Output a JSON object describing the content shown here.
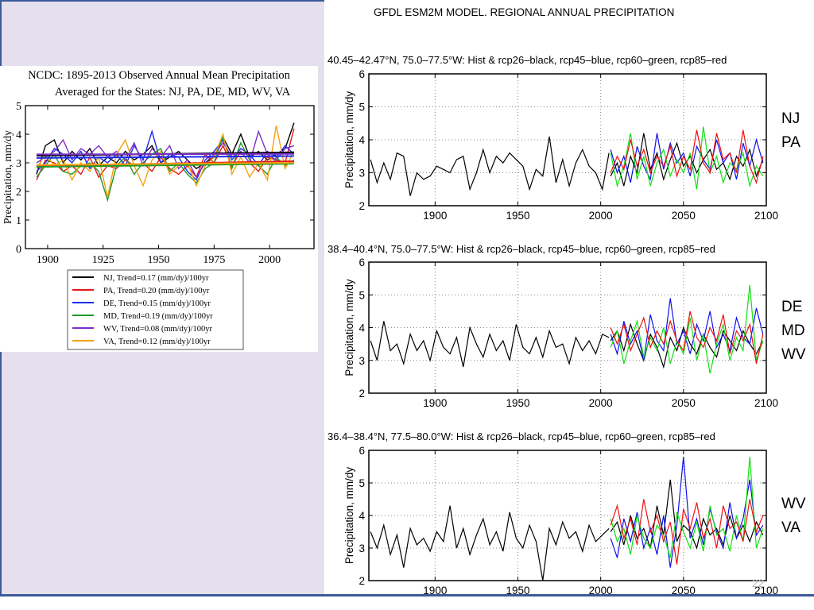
{
  "slide": {
    "right_title": "GFDL ESM2M MODEL.  REGIONAL ANNUAL PRECIPITATION",
    "page_number": "22",
    "region_labels": [
      [
        "NJ",
        "PA"
      ],
      [
        "DE",
        "MD",
        "WV"
      ],
      [
        "WV",
        "VA"
      ]
    ],
    "background_color": "#e6e0ee",
    "border_color": "#3b5a9a"
  },
  "chart_data": [
    {
      "type": "line",
      "title": "NCDC: 1895-2013 Observed Annual Mean Precipitation",
      "subtitle": "Averaged for the States: NJ, PA, DE, MD, WV, VA",
      "xlabel": "",
      "ylabel": "Precipitation, mm/dy",
      "xlim": [
        1890,
        2020
      ],
      "ylim": [
        0,
        5
      ],
      "xticks": [
        1900,
        1925,
        1950,
        1975,
        2000
      ],
      "yticks": [
        0,
        1,
        2,
        3,
        4,
        5
      ],
      "grid": false,
      "legend": "bottom",
      "x_start": 1895,
      "x_step": 4,
      "series": [
        {
          "name": "NJ, Trend=0.17 (mm/dy)/100yr",
          "color": "#000000",
          "values": [
            2.6,
            3.6,
            3.8,
            3.0,
            3.4,
            3.1,
            3.5,
            2.9,
            3.2,
            3.0,
            3.4,
            3.1,
            3.3,
            3.6,
            3.0,
            3.2,
            3.4,
            3.1,
            2.8,
            3.0,
            3.2,
            3.9,
            3.3,
            4.0,
            3.2,
            3.4,
            3.1,
            3.3,
            3.5,
            4.4
          ]
        },
        {
          "name": "PA, Trend=0.20 (mm/dy)/100yr",
          "color": "#e8141c",
          "values": [
            2.4,
            3.1,
            3.0,
            2.7,
            2.9,
            2.6,
            3.2,
            2.5,
            2.9,
            2.8,
            3.1,
            2.9,
            3.0,
            2.7,
            3.2,
            2.8,
            2.6,
            2.9,
            2.5,
            3.3,
            3.0,
            3.6,
            2.9,
            3.4,
            3.0,
            2.7,
            3.2,
            3.1,
            3.0,
            4.2
          ]
        },
        {
          "name": "DE, Trend=0.15 (mm/dy)/100yr",
          "color": "#1a2cf0",
          "values": [
            2.7,
            3.0,
            3.5,
            3.3,
            3.0,
            3.4,
            2.8,
            3.2,
            3.0,
            3.3,
            2.9,
            3.6,
            3.1,
            4.1,
            3.0,
            3.3,
            3.2,
            2.7,
            2.4,
            3.1,
            3.4,
            3.8,
            3.1,
            3.5,
            3.3,
            2.9,
            3.4,
            3.2,
            3.6,
            3.3
          ]
        },
        {
          "name": "MD, Trend=0.19 (mm/dy)/100yr",
          "color": "#1f9a2a",
          "values": [
            2.5,
            2.9,
            3.3,
            2.7,
            2.6,
            2.9,
            3.0,
            2.7,
            1.7,
            2.9,
            3.2,
            2.6,
            3.0,
            3.3,
            3.5,
            2.7,
            3.0,
            2.6,
            2.3,
            2.8,
            3.0,
            3.9,
            2.8,
            3.7,
            3.1,
            2.9,
            2.6,
            3.2,
            2.9,
            3.1
          ]
        },
        {
          "name": "WV, Trend=0.08 (mm/dy)/100yr",
          "color": "#7b2fc8",
          "values": [
            3.0,
            3.2,
            3.4,
            3.8,
            3.1,
            3.5,
            3.3,
            3.6,
            3.2,
            3.4,
            3.1,
            3.7,
            2.9,
            3.5,
            3.2,
            3.6,
            2.8,
            3.1,
            2.5,
            3.0,
            3.3,
            3.7,
            3.2,
            3.4,
            3.0,
            4.1,
            3.3,
            3.1,
            3.5,
            3.6
          ]
        },
        {
          "name": "VA, Trend=0.12 (mm/dy)/100yr",
          "color": "#f5a20f",
          "values": [
            2.8,
            3.3,
            2.9,
            3.1,
            2.4,
            3.0,
            2.7,
            3.2,
            1.8,
            3.3,
            3.8,
            2.9,
            2.2,
            3.1,
            3.4,
            2.6,
            2.9,
            3.0,
            2.2,
            2.9,
            3.2,
            4.0,
            2.6,
            3.2,
            2.5,
            3.0,
            2.4,
            4.3,
            2.8,
            3.4
          ]
        }
      ]
    },
    {
      "type": "line",
      "title": "40.45–42.47°N, 75.0–77.5°W: Hist & rcp26–black, rcp45–blue, rcp60–green, rcp85–red",
      "ylabel": "Precipitation, mm/dy",
      "xlim": [
        1860,
        2100
      ],
      "ylim": [
        2,
        6
      ],
      "xticks": [
        1900,
        1950,
        2000,
        2050,
        2100
      ],
      "yticks": [
        2,
        3,
        4,
        5,
        6
      ],
      "grid": true,
      "hist": {
        "x_start": 1861,
        "x_step": 4,
        "color": "#000000",
        "values": [
          3.4,
          2.7,
          3.3,
          2.8,
          3.6,
          3.5,
          2.3,
          3.0,
          2.8,
          2.9,
          3.2,
          3.1,
          3.0,
          3.4,
          3.5,
          2.5,
          3.0,
          3.7,
          3.0,
          3.5,
          3.3,
          3.6,
          3.4,
          3.2,
          2.5,
          3.1,
          2.9,
          4.1,
          2.7,
          3.4,
          2.6,
          3.3,
          3.7,
          3.2,
          3.0,
          2.5,
          3.6
        ]
      },
      "projections": {
        "x_start": 2006,
        "x_step": 4,
        "series": [
          {
            "name": "rcp26",
            "color": "#000000",
            "values": [
              2.9,
              3.3,
              2.6,
              3.5,
              3.0,
              4.2,
              3.1,
              3.6,
              2.8,
              3.4,
              3.9,
              3.2,
              3.5,
              3.0,
              3.4,
              3.7,
              3.1,
              3.3,
              2.8,
              3.5,
              3.2,
              3.7,
              2.9,
              3.4
            ]
          },
          {
            "name": "rcp45",
            "color": "#1010ee",
            "values": [
              3.7,
              3.0,
              3.5,
              2.7,
              3.8,
              3.2,
              2.8,
              4.2,
              3.1,
              3.9,
              3.3,
              3.6,
              2.9,
              3.8,
              3.4,
              3.1,
              4.0,
              3.3,
              3.6,
              2.8,
              3.9,
              3.2,
              4.0,
              3.3
            ]
          },
          {
            "name": "rcp60",
            "color": "#10e010",
            "values": [
              3.6,
              2.6,
              3.2,
              4.2,
              2.8,
              3.5,
              2.6,
              3.3,
              3.7,
              2.9,
              3.4,
              3.0,
              3.6,
              2.5,
              4.4,
              3.0,
              3.5,
              2.7,
              3.3,
              3.1,
              3.6,
              2.6,
              3.2,
              2.9
            ]
          },
          {
            "name": "rcp85",
            "color": "#ee1010",
            "values": [
              3.0,
              3.5,
              3.1,
              4.0,
              3.2,
              3.7,
              3.0,
              3.5,
              3.2,
              3.8,
              2.9,
              3.5,
              3.1,
              4.3,
              3.3,
              3.0,
              4.2,
              3.4,
              3.6,
              3.0,
              4.3,
              3.2,
              2.7,
              3.5
            ]
          }
        ]
      }
    },
    {
      "type": "line",
      "title": "38.4–40.4°N, 75.0–77.5°W: Hist & rcp26–black, rcp45–blue, rcp60–green, rcp85–red",
      "ylabel": "Precipitation, mm/dy",
      "xlim": [
        1860,
        2100
      ],
      "ylim": [
        2,
        6
      ],
      "xticks": [
        1900,
        1950,
        2000,
        2050,
        2100
      ],
      "yticks": [
        2,
        3,
        4,
        5,
        6
      ],
      "grid": true,
      "hist": {
        "x_start": 1861,
        "x_step": 4,
        "color": "#000000",
        "values": [
          3.6,
          3.0,
          4.2,
          3.3,
          3.5,
          2.9,
          3.8,
          3.3,
          3.6,
          3.0,
          3.9,
          3.4,
          3.2,
          3.7,
          2.8,
          4.0,
          3.5,
          3.1,
          3.8,
          3.3,
          3.6,
          3.0,
          4.1,
          3.4,
          3.2,
          3.7,
          3.1,
          3.9,
          3.4,
          3.5,
          2.9,
          3.7,
          3.3,
          3.6,
          3.2,
          3.8,
          3.7
        ]
      },
      "projections": {
        "x_start": 2006,
        "x_step": 4,
        "series": [
          {
            "name": "rcp26",
            "color": "#000000",
            "values": [
              3.6,
              3.9,
              3.3,
              4.1,
              3.5,
              3.0,
              3.8,
              3.4,
              2.8,
              3.7,
              3.3,
              4.0,
              3.5,
              3.2,
              3.8,
              3.4,
              3.1,
              3.9,
              3.6,
              3.3,
              3.9,
              3.5,
              3.2,
              3.6
            ]
          },
          {
            "name": "rcp45",
            "color": "#1010ee",
            "values": [
              3.8,
              3.2,
              4.2,
              3.5,
              3.9,
              3.0,
              4.4,
              3.6,
              3.3,
              4.9,
              3.5,
              3.9,
              3.2,
              4.1,
              3.6,
              4.5,
              3.4,
              3.8,
              3.3,
              4.3,
              3.7,
              3.5,
              4.6,
              3.8
            ]
          },
          {
            "name": "rcp60",
            "color": "#10e010",
            "values": [
              3.4,
              3.9,
              2.9,
              3.6,
              4.2,
              3.1,
              3.7,
              3.3,
              4.0,
              2.9,
              3.6,
              3.2,
              4.3,
              3.0,
              3.8,
              2.6,
              3.5,
              4.1,
              3.0,
              3.7,
              3.3,
              5.3,
              3.0,
              3.6
            ]
          },
          {
            "name": "rcp85",
            "color": "#ee1010",
            "values": [
              4.0,
              3.5,
              4.1,
              3.3,
              3.8,
              4.3,
              3.4,
              3.9,
              3.5,
              4.2,
              3.6,
              3.3,
              4.5,
              3.7,
              3.4,
              4.0,
              3.6,
              4.4,
              3.2,
              3.9,
              3.6,
              4.1,
              2.9,
              3.8
            ]
          }
        ]
      }
    },
    {
      "type": "line",
      "title": "36.4–38.4°N, 77.5–80.0°W: Hist & rcp26–black, rcp45–blue, rcp60–green, rcp85–red",
      "ylabel": "Precipitation, mm/dy",
      "xlim": [
        1860,
        2100
      ],
      "ylim": [
        2,
        6
      ],
      "xticks": [
        1900,
        1950,
        2000,
        2050,
        2100
      ],
      "yticks": [
        2,
        3,
        4,
        5,
        6
      ],
      "grid": true,
      "hist": {
        "x_start": 1861,
        "x_step": 4,
        "color": "#000000",
        "values": [
          3.5,
          3.0,
          3.7,
          2.8,
          3.4,
          2.4,
          3.6,
          3.1,
          3.3,
          2.9,
          3.5,
          3.2,
          4.3,
          3.0,
          3.6,
          2.8,
          3.4,
          3.9,
          3.1,
          3.5,
          2.9,
          4.1,
          3.3,
          3.0,
          3.7,
          3.2,
          2.0,
          3.6,
          3.1,
          3.8,
          3.3,
          3.5,
          2.9,
          3.7,
          3.2,
          3.4,
          3.6
        ]
      },
      "projections": {
        "x_start": 2006,
        "x_step": 4,
        "series": [
          {
            "name": "rcp26",
            "color": "#000000",
            "values": [
              3.5,
              3.8,
              3.1,
              4.0,
              3.3,
              3.6,
              3.0,
              4.3,
              3.4,
              5.1,
              3.2,
              3.7,
              3.5,
              3.0,
              3.9,
              3.4,
              3.6,
              3.1,
              4.0,
              3.3,
              3.7,
              3.2,
              3.8,
              3.4
            ]
          },
          {
            "name": "rcp45",
            "color": "#1010ee",
            "values": [
              3.3,
              2.7,
              3.9,
              3.2,
              4.1,
              3.0,
              3.6,
              2.8,
              4.0,
              2.4,
              3.7,
              5.8,
              3.3,
              3.9,
              3.1,
              4.2,
              3.5,
              3.0,
              4.4,
              3.3,
              3.9,
              5.1,
              3.4,
              3.7
            ]
          },
          {
            "name": "rcp60",
            "color": "#10e010",
            "values": [
              3.9,
              3.2,
              3.6,
              2.8,
              4.0,
              3.3,
              3.0,
              3.7,
              3.4,
              2.7,
              4.1,
              3.5,
              3.0,
              3.8,
              2.9,
              4.3,
              3.4,
              3.6,
              2.9,
              4.0,
              3.2,
              5.8,
              3.0,
              3.6
            ]
          },
          {
            "name": "rcp85",
            "color": "#ee1010",
            "values": [
              3.7,
              4.3,
              3.3,
              3.9,
              3.1,
              4.5,
              3.5,
              4.0,
              3.2,
              3.8,
              2.5,
              4.2,
              3.6,
              4.4,
              3.3,
              3.9,
              3.0,
              4.3,
              3.6,
              3.8,
              3.2,
              4.5,
              3.5,
              4.0
            ]
          }
        ]
      }
    }
  ]
}
